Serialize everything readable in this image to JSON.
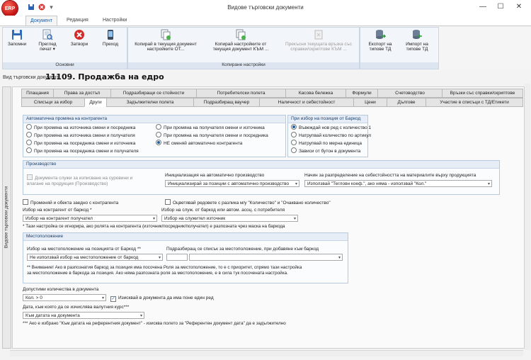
{
  "window": {
    "title": "Видове търговски документи",
    "logo_text": "ERP",
    "controls": [
      "—",
      "☐",
      "✕"
    ]
  },
  "ribbon": {
    "tabs": [
      "Документ",
      "Редакция",
      "Настройки"
    ],
    "groups": {
      "basic": {
        "label": "Основни",
        "buttons": [
          {
            "label": "Запомни"
          },
          {
            "label": "Преглед печат ▾"
          },
          {
            "label": "Затвори"
          },
          {
            "label": "Преход"
          }
        ]
      },
      "copy": {
        "label": "Копиране настройки",
        "buttons": [
          {
            "label": "Копирай в текущия документ настройките ОТ..."
          },
          {
            "label": "Копирай настройките от текущия документ КЪМ ..."
          },
          {
            "label": "Прекъсни текущата връзка със справки/скриптове КЪМ ..."
          }
        ]
      },
      "export": {
        "buttons": [
          {
            "label": "Експорт на типове ТД"
          },
          {
            "label": "Импорт на типове ТД"
          }
        ]
      }
    }
  },
  "document": {
    "prefix": "Вид търговски документ:",
    "number": "11109. Продажба на едро"
  },
  "sidebar": {
    "vertical_label": "Видове търговски документи"
  },
  "tabs_row1": [
    "Плащания",
    "Права за достъп",
    "Подразбиращи се стойности",
    "Потребителски полета",
    "Касова бележка",
    "Формули",
    "Счетоводство",
    "Връзки със справки/скриптове"
  ],
  "tabs_row2": [
    "Списъци за избор",
    "Други",
    "Задължителни полета",
    "Подразбиращ ваучер",
    "Наличност и себестойност",
    "Цени",
    "Дългове",
    "Участие в списъци с ТД/Етикети"
  ],
  "active_tab": "Други",
  "auto_change": {
    "title": "Автоматична промяна на контрагента",
    "left_options": [
      "При промяна на източника смени и посредника",
      "При промяна на източника смени и получателя",
      "При промяна на посредника смени и източника",
      "При промяна на посредника смени и получателя"
    ],
    "right_options": [
      "При промяна на получателя смени и източника",
      "При промяна на получателя смени и посредника",
      "НЕ сменяй автоматично контрагента"
    ]
  },
  "barcode_add": {
    "title": "При избор на позиция от Баркод",
    "options": [
      "Въвеждай нов ред с количество 1",
      "Натрупвай количество по артикул",
      "Натрупвай по мерна единица",
      "Зависи от бутон в документа"
    ]
  },
  "production": {
    "title": "Производство",
    "checkbox_label": "Документа служи за изписване на суровини и влагане на продукция (Производство)",
    "init_label": "Инициализация на автоматично производство",
    "init_value": "Инициализирай за позиции с автоматично производство",
    "cost_label": "Начин за разпределение на себестойността на материалите върху продукцията",
    "cost_value": "Използвай \"Тегловн коеф.\", ако няма - използвай \"Кол.\""
  },
  "misc": {
    "chk_changed": "Променяй и обекта заедно с контрагента",
    "chk_diff": "Оцветявай редовете с разлика м/у \"Количество\" и \"Очаквано количество\"",
    "contractor_barcode_label": "Избор на контрагент от баркод *",
    "contractor_barcode_value": "Избор на контрагент получател",
    "employee_label": "Избор на служ. от баркод или автом. асоц. с потребителя",
    "employee_value": "Избор на служител източник",
    "note1": "* Тази настройка се игнорира, ако ролята на контрагента (източник/посредник/получател) е разпозната чрез маска на баркода"
  },
  "location": {
    "title": "Местоположение",
    "select_label": "Избор на местоположение на позицията от Баркод **",
    "select_value": "Не използвай избор на местоположение от баркод",
    "suggest_label": "Подразбиращ се списък за местоположение, при добавяне към баркод",
    "note_line1": "** Внимание! Ако в разпознатия баркод за позиция има посочена Роля за местоположение, то е с приоритет, спрямо тази настройка",
    "note_line2": "за местоположение в баркода за позиция. Ако няма разпозната роля за местоположение, е в сила тук посочената настройка."
  },
  "allowed": {
    "label": "Допустими количества в документа",
    "value": "Кол. > 0",
    "chk_label": "Изисквай в документа да има поне един ред"
  },
  "date_rate": {
    "label": "Дата, към която да се изчислява валутния курс***",
    "value": "Към датата на документа",
    "note": "*** Ако е избрано \"Към датата на референтния документ\" - изисква полето за \"Референтен документ дата\" да е задължително"
  }
}
